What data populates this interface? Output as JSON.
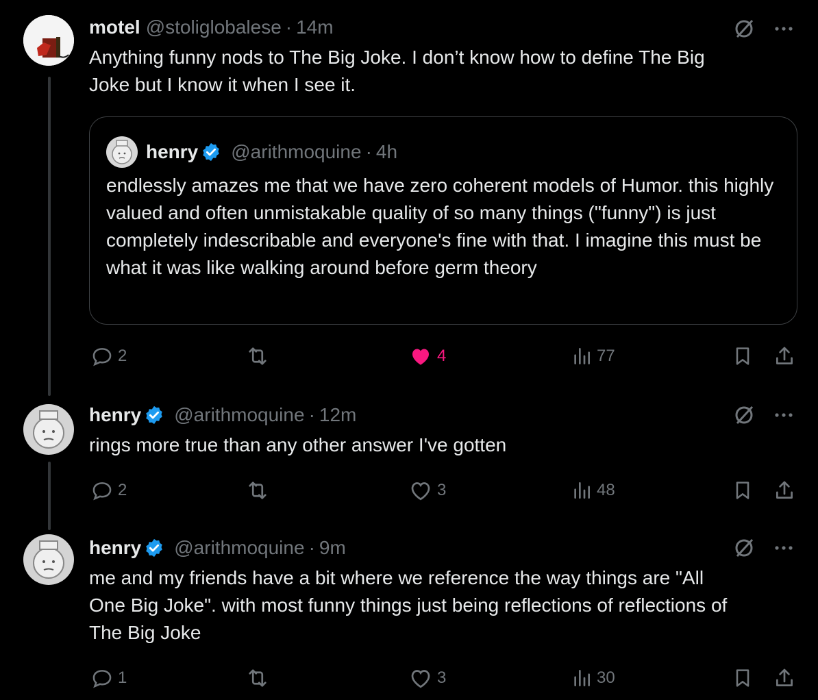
{
  "colors": {
    "background": "#000000",
    "text": "#e7e9ea",
    "muted": "#71767b",
    "verified": "#1d9bf0",
    "like": "#f91880",
    "border": "#3e4144"
  },
  "tweets": [
    {
      "name": "motel",
      "handle": "@stoliglobalese",
      "sep": "·",
      "time": "14m",
      "verified": false,
      "text": "Anything funny nods to The Big Joke. I don’t know how to define The Big\nJoke but I know it when I see it.",
      "quote": {
        "name": "henry",
        "handle": "@arithmoquine",
        "sep": "·",
        "time": "4h",
        "verified": true,
        "text": "endlessly amazes me that we have zero coherent models of Humor. this highly valued and often unmistakable quality of so many things (\"funny\") is just completely indescribable and everyone's fine with that. I imagine this must be what it was like walking around before germ theory"
      },
      "replies": "2",
      "reposts": "",
      "likes": "4",
      "liked": true,
      "views": "77"
    },
    {
      "name": "henry",
      "handle": "@arithmoquine",
      "sep": "·",
      "time": "12m",
      "verified": true,
      "text": "rings more true than any other answer I've gotten",
      "replies": "2",
      "reposts": "",
      "likes": "3",
      "liked": false,
      "views": "48"
    },
    {
      "name": "henry",
      "handle": "@arithmoquine",
      "sep": "·",
      "time": "9m",
      "verified": true,
      "text": "me and my friends have a bit where we reference the way things are \"All\nOne Big Joke\". with most funny things just being reflections of reflections of\nThe Big Joke",
      "replies": "1",
      "reposts": "",
      "likes": "3",
      "liked": false,
      "views": "30"
    }
  ],
  "icons": [
    "reply-icon",
    "repost-icon",
    "like-icon",
    "views-icon",
    "bookmark-icon",
    "share-icon",
    "grok-icon",
    "more-icon",
    "verified-badge-icon"
  ]
}
